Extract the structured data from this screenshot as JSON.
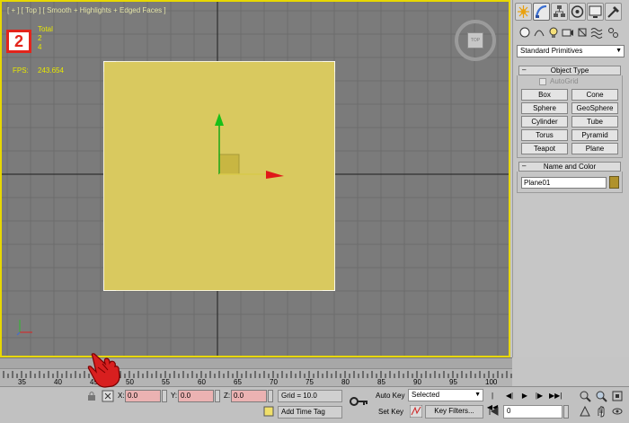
{
  "viewport": {
    "label": "[ + ] [ Top ] [ Smooth + Highlights + Edged Faces ]",
    "step_badge": "2",
    "stats_total": "Total",
    "stats_v1": "2",
    "stats_v2": "4",
    "fps_label": "FPS:",
    "fps_value": "243.654",
    "viewcube_face": "TOP",
    "colors": {
      "background": "#7b7b7b",
      "border": "#e8d800",
      "plane": "#d9c95f",
      "stats": "#e8e800"
    }
  },
  "command_panel": {
    "tabs": [
      "create-icon",
      "modify-icon",
      "hierarchy-icon",
      "motion-icon",
      "display-icon",
      "utilities-icon"
    ],
    "categories": [
      "geometry-icon",
      "shapes-icon",
      "lights-icon",
      "cameras-icon",
      "helpers-icon",
      "space-warps-icon",
      "systems-icon"
    ],
    "dropdown": "Standard Primitives",
    "object_type_title": "Object Type",
    "autogrid_label": "AutoGrid",
    "buttons": [
      "Box",
      "Cone",
      "Sphere",
      "GeoSphere",
      "Cylinder",
      "Tube",
      "Torus",
      "Pyramid",
      "Teapot",
      "Plane"
    ],
    "name_color_title": "Name and Color",
    "name_value": "Plane01",
    "object_color": "#b0922c"
  },
  "timeline": {
    "ticks": [
      "35",
      "40",
      "45",
      "50",
      "55",
      "60",
      "65",
      "70",
      "75",
      "80",
      "85",
      "90",
      "95",
      "100"
    ]
  },
  "statusbar": {
    "x_label": "X:",
    "x_value": "0.0",
    "y_label": "Y:",
    "y_value": "0.0",
    "z_label": "Z:",
    "z_value": "0.0",
    "grid_label": "Grid = 10.0",
    "add_time_tag": "Add Time Tag",
    "auto_key": "Auto Key",
    "set_key": "Set Key",
    "key_mode_select": "Selected",
    "key_filters": "Key Filters...",
    "frame_value": "0",
    "field_highlight_color": "#ebb2b2"
  }
}
